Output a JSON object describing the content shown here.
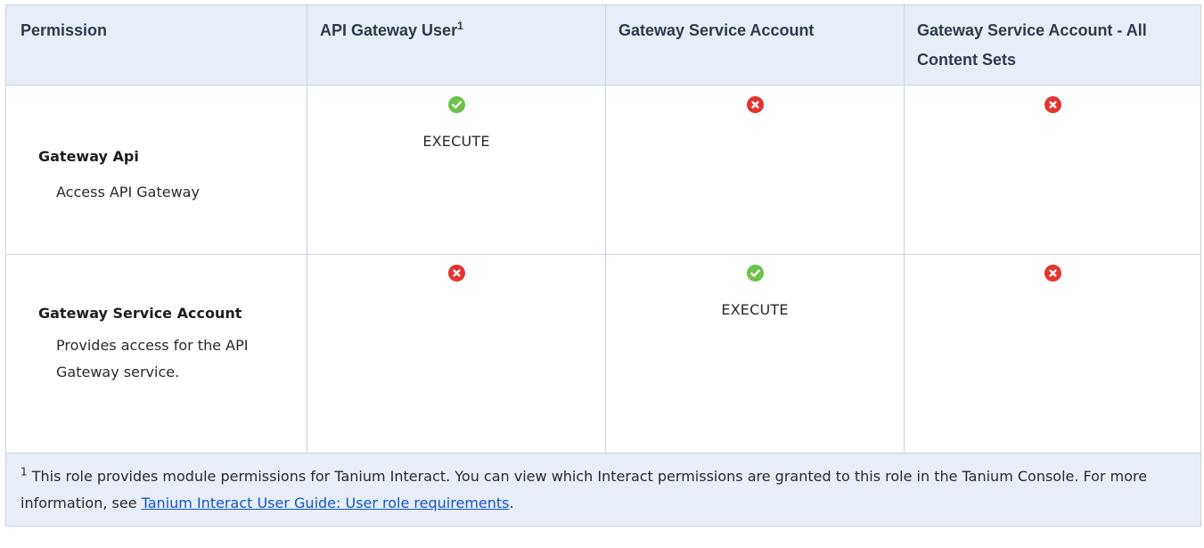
{
  "table": {
    "headers": [
      {
        "label": "Permission",
        "footnote": ""
      },
      {
        "label": "API Gateway User",
        "footnote": "1"
      },
      {
        "label": "Gateway Service Account",
        "footnote": ""
      },
      {
        "label": "Gateway Service Account - All Content Sets",
        "footnote": ""
      }
    ],
    "rows": [
      {
        "name": "Gateway Api",
        "description": "Access API Gateway",
        "cells": [
          {
            "status": "allowed",
            "icon": "check-circle-icon",
            "text": "EXECUTE"
          },
          {
            "status": "denied",
            "icon": "x-circle-icon",
            "text": ""
          },
          {
            "status": "denied",
            "icon": "x-circle-icon",
            "text": ""
          }
        ]
      },
      {
        "name": "Gateway Service Account",
        "description": "Provides access for the API Gateway service.",
        "cells": [
          {
            "status": "denied",
            "icon": "x-circle-icon",
            "text": ""
          },
          {
            "status": "allowed",
            "icon": "check-circle-icon",
            "text": "EXECUTE"
          },
          {
            "status": "denied",
            "icon": "x-circle-icon",
            "text": ""
          }
        ]
      }
    ],
    "footnote": {
      "marker": "1",
      "text_before": " This role provides module permissions for Tanium Interact. You can view which Interact permissions are granted to this role in the Tanium Console. For more information, see ",
      "link_text": "Tanium Interact User Guide: User role requirements",
      "text_after": "."
    }
  },
  "colors": {
    "header_bg": "#e7eef8",
    "border": "#c9d3e0",
    "allowed": "#6cc24a",
    "denied": "#e3342f",
    "link": "#1155cc"
  }
}
